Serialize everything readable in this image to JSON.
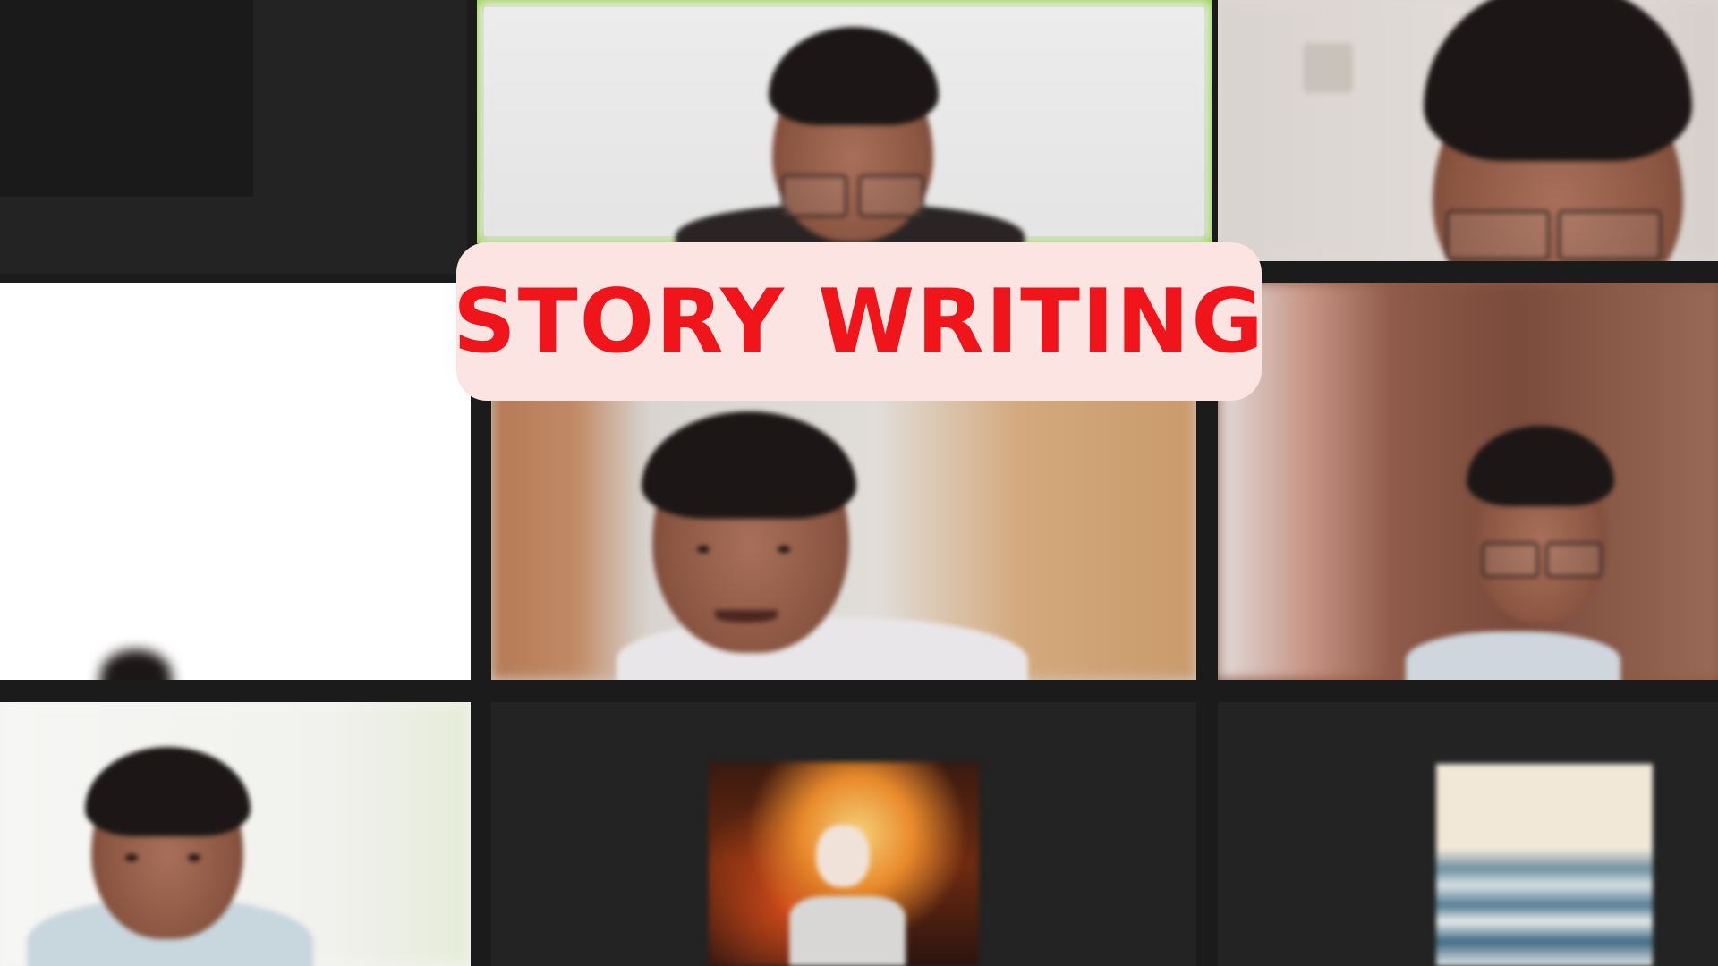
{
  "banner": {
    "title": "STORY WRITING"
  },
  "meeting": {
    "layout": "gallery-view",
    "active_speaker_color": "#7fd320",
    "accent_color": "#f0151b",
    "banner_background": "#fce4e2",
    "participants": [
      {
        "tile": "top-left",
        "video": "off"
      },
      {
        "tile": "top-center",
        "video": "on",
        "active_speaker": true
      },
      {
        "tile": "top-right",
        "video": "on"
      },
      {
        "tile": "middle-left",
        "video": "on"
      },
      {
        "tile": "middle-center",
        "video": "on"
      },
      {
        "tile": "middle-right",
        "video": "on"
      },
      {
        "tile": "bottom-left",
        "video": "on"
      },
      {
        "tile": "bottom-center",
        "video": "off",
        "avatar": "anime-flame-character"
      },
      {
        "tile": "bottom-right",
        "video": "off",
        "avatar": "ocean-waves-painting"
      }
    ]
  }
}
